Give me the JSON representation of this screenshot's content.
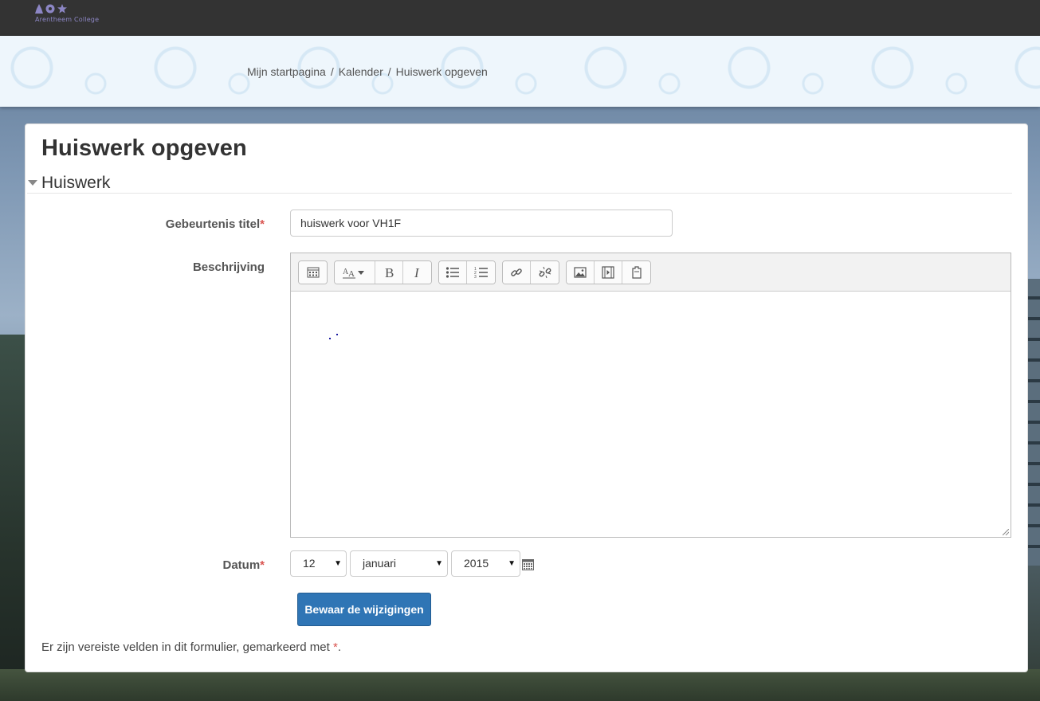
{
  "branding": {
    "name": "Arentheem College"
  },
  "breadcrumb": {
    "items": [
      "Mijn startpagina",
      "Kalender",
      "Huiswerk opgeven"
    ],
    "separator": "/"
  },
  "page": {
    "title": "Huiswerk opgeven"
  },
  "section": {
    "legend": "Huiswerk"
  },
  "form": {
    "title_label": "Gebeurtenis titel",
    "title_value": "huiswerk voor VH1F",
    "description_label": "Beschrijving",
    "date_label": "Datum",
    "required_marker": "*",
    "date": {
      "day": "12",
      "month": "januari",
      "year": "2015"
    },
    "save_label": "Bewaar de wijzigingen",
    "required_note_text": "Er zijn vereiste velden in dit formulier, gemarkeerd met ",
    "required_note_end": "."
  },
  "toolbar": {
    "groups": [
      [
        "toggle-toolbar-icon"
      ],
      [
        "font-style-icon",
        "bold-icon",
        "italic-icon"
      ],
      [
        "bullet-list-icon",
        "numbered-list-icon"
      ],
      [
        "link-icon",
        "unlink-icon"
      ],
      [
        "image-icon",
        "media-icon",
        "file-icon"
      ]
    ]
  },
  "colors": {
    "navbar": "#333333",
    "primary_button": "#2f75b5",
    "required": "#d9534f",
    "header_band": "#eef6fc"
  }
}
